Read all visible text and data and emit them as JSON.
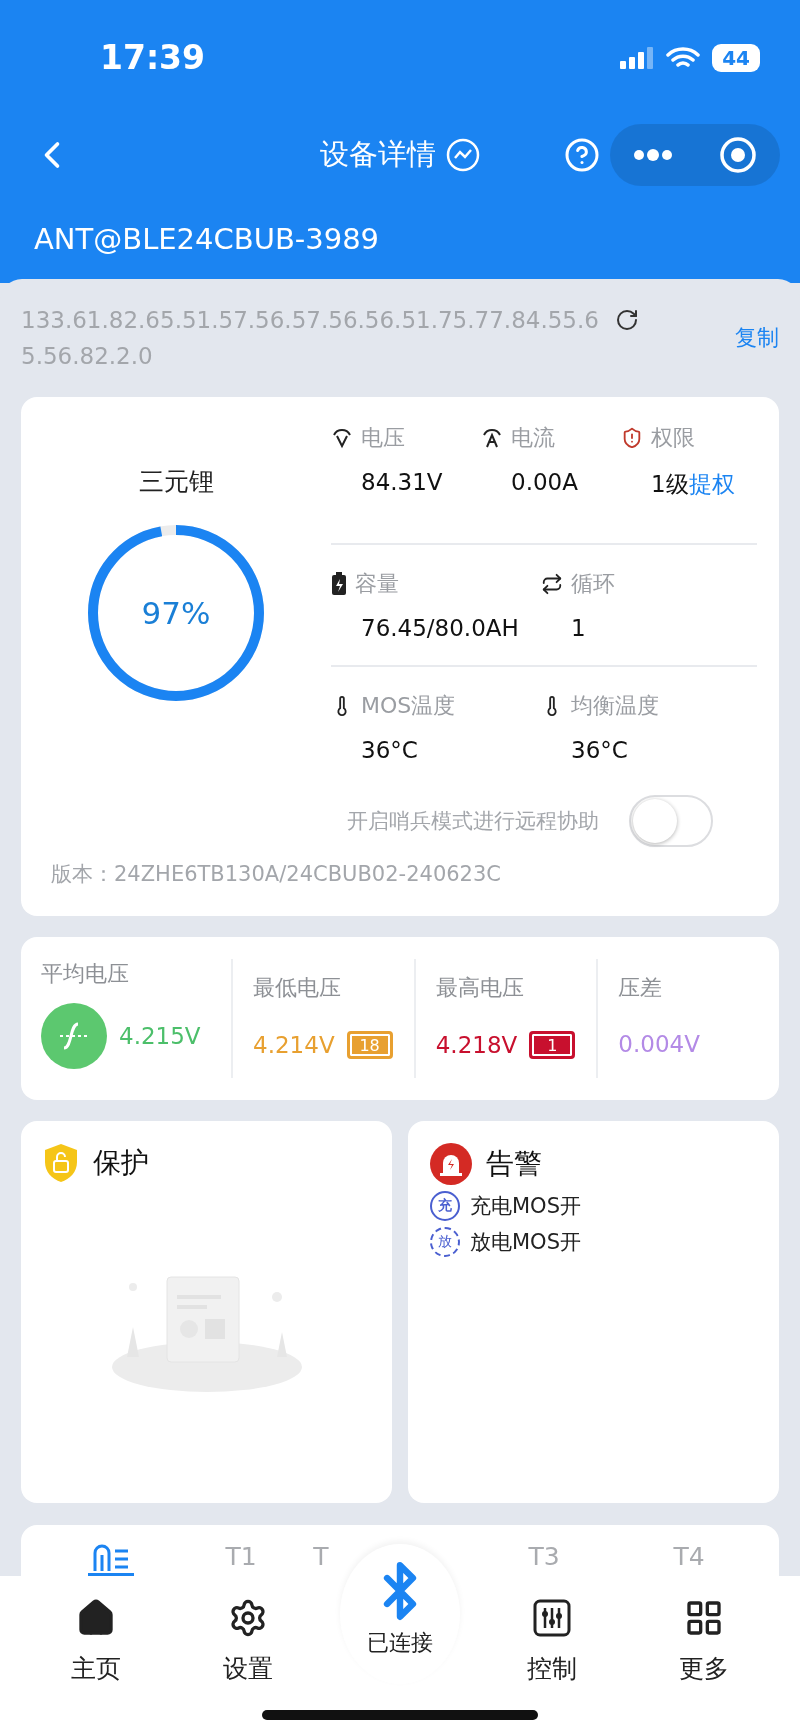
{
  "status_bar": {
    "time": "17:39",
    "battery": "44"
  },
  "nav": {
    "title": "设备详情"
  },
  "device_name": "ANT@BLE24CBUB-3989",
  "device_id": {
    "value": "133.61.82.65.51.57.56.57.56.56.51.75.77.84.55.65.56.82.2.0",
    "copy": "复制"
  },
  "battery_card": {
    "chemistry": "三元锂",
    "level": 0.97,
    "percent": "97%",
    "metric_rows": [
      [
        {
          "kind": "volt",
          "label": "电压",
          "value": "84.31V"
        },
        {
          "kind": "amp",
          "label": "电流",
          "value": "0.00A"
        },
        {
          "kind": "shield",
          "label": "权限",
          "value": "1级",
          "link": "提权"
        }
      ],
      [
        {
          "kind": "battery",
          "label": "容量",
          "value": "76.45/80.0AH"
        },
        {
          "kind": "cycle",
          "label": "循环",
          "value": "1"
        }
      ],
      [
        {
          "kind": "thermo",
          "label": "MOS温度",
          "value": "36°C"
        },
        {
          "kind": "thermo",
          "label": "均衡温度",
          "value": "36°C"
        }
      ]
    ],
    "sentinel": {
      "label": "开启哨兵模式进行远程协助",
      "on": false
    },
    "version": "版本：24ZHE6TB130A/24CBUB02-240623C"
  },
  "voltage_stats": [
    {
      "kind": "average",
      "label": "平均电压",
      "value": "4.215V",
      "color": "#4cbf6a"
    },
    {
      "kind": "min",
      "label": "最低电压",
      "value": "4.214V",
      "cell": "18",
      "color": "#e8a030"
    },
    {
      "kind": "max",
      "label": "最高电压",
      "value": "4.218V",
      "cell": "1",
      "color": "#c8102e"
    },
    {
      "kind": "diff",
      "label": "压差",
      "value": "0.004V",
      "color": "#b38ae6"
    }
  ],
  "protection": {
    "title": "保护"
  },
  "alarm": {
    "title": "告警",
    "items": [
      {
        "kind": "charge",
        "badge": "充",
        "label": "充电MOS开"
      },
      {
        "kind": "discharge",
        "badge": "放",
        "label": "放电MOS开"
      }
    ]
  },
  "tabs": [
    {
      "kind": "icon",
      "selected": true
    },
    {
      "kind": "text",
      "label": "T1",
      "selected": false
    },
    {
      "kind": "text",
      "label": "T",
      "selected": false
    },
    {
      "kind": "text",
      "label": "T3",
      "selected": false
    },
    {
      "kind": "text",
      "label": "T4",
      "selected": false
    }
  ],
  "bottom_nav": [
    {
      "kind": "home",
      "label": "主页"
    },
    {
      "kind": "settings",
      "label": "设置"
    },
    {
      "kind": "bluetooth",
      "label": "已连接"
    },
    {
      "kind": "control",
      "label": "控制"
    },
    {
      "kind": "more",
      "label": "更多"
    }
  ]
}
